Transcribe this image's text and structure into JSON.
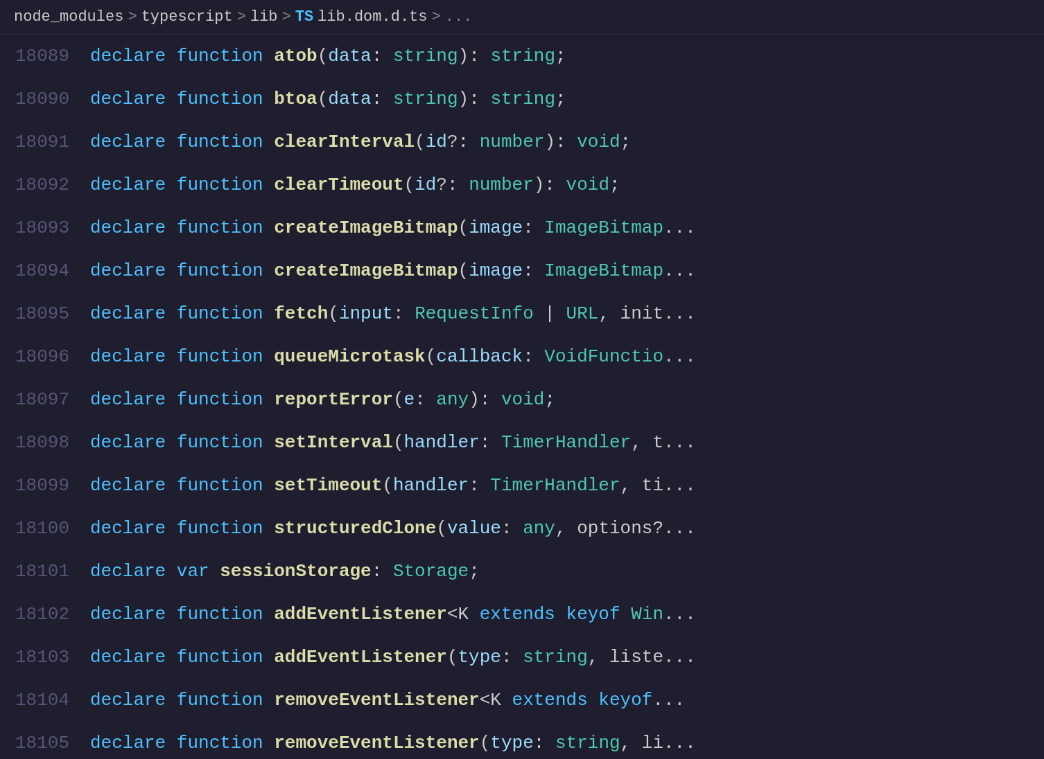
{
  "breadcrumb": {
    "path": [
      "node_modules",
      "typescript",
      "lib"
    ],
    "ts_badge": "TS",
    "filename": "lib.dom.d.ts",
    "ellipsis": "..."
  },
  "lines": [
    {
      "number": "18089",
      "tokens": [
        {
          "t": "declare",
          "c": "kw-declare"
        },
        {
          "t": " "
        },
        {
          "t": "function",
          "c": "kw-function"
        },
        {
          "t": " "
        },
        {
          "t": "atob",
          "c": "fn-name"
        },
        {
          "t": "("
        },
        {
          "t": "data",
          "c": "param-name"
        },
        {
          "t": ": "
        },
        {
          "t": "string",
          "c": "kw-string"
        },
        {
          "t": "): "
        },
        {
          "t": "string",
          "c": "kw-string"
        },
        {
          "t": ";"
        }
      ]
    },
    {
      "number": "18090",
      "tokens": [
        {
          "t": "declare",
          "c": "kw-declare"
        },
        {
          "t": " "
        },
        {
          "t": "function",
          "c": "kw-function"
        },
        {
          "t": " "
        },
        {
          "t": "btoa",
          "c": "fn-name"
        },
        {
          "t": "("
        },
        {
          "t": "data",
          "c": "param-name"
        },
        {
          "t": ": "
        },
        {
          "t": "string",
          "c": "kw-string"
        },
        {
          "t": "): "
        },
        {
          "t": "string",
          "c": "kw-string"
        },
        {
          "t": ";"
        }
      ]
    },
    {
      "number": "18091",
      "tokens": [
        {
          "t": "declare",
          "c": "kw-declare"
        },
        {
          "t": " "
        },
        {
          "t": "function",
          "c": "kw-function"
        },
        {
          "t": " "
        },
        {
          "t": "clearInterval",
          "c": "fn-name"
        },
        {
          "t": "("
        },
        {
          "t": "id",
          "c": "param-name"
        },
        {
          "t": "?: "
        },
        {
          "t": "number",
          "c": "kw-number"
        },
        {
          "t": "): "
        },
        {
          "t": "void",
          "c": "kw-void"
        },
        {
          "t": ";"
        }
      ]
    },
    {
      "number": "18092",
      "tokens": [
        {
          "t": "declare",
          "c": "kw-declare"
        },
        {
          "t": " "
        },
        {
          "t": "function",
          "c": "kw-function"
        },
        {
          "t": " "
        },
        {
          "t": "clearTimeout",
          "c": "fn-name"
        },
        {
          "t": "("
        },
        {
          "t": "id",
          "c": "param-name"
        },
        {
          "t": "?: "
        },
        {
          "t": "number",
          "c": "kw-number"
        },
        {
          "t": "): "
        },
        {
          "t": "void",
          "c": "kw-void"
        },
        {
          "t": ";"
        }
      ]
    },
    {
      "number": "18093",
      "tokens": [
        {
          "t": "declare",
          "c": "kw-declare"
        },
        {
          "t": " "
        },
        {
          "t": "function",
          "c": "kw-function"
        },
        {
          "t": " "
        },
        {
          "t": "createImageBitmap",
          "c": "fn-name"
        },
        {
          "t": "("
        },
        {
          "t": "image",
          "c": "param-name"
        },
        {
          "t": ": "
        },
        {
          "t": "ImageBitmap",
          "c": "type-name"
        },
        {
          "t": "..."
        }
      ]
    },
    {
      "number": "18094",
      "tokens": [
        {
          "t": "declare",
          "c": "kw-declare"
        },
        {
          "t": " "
        },
        {
          "t": "function",
          "c": "kw-function"
        },
        {
          "t": " "
        },
        {
          "t": "createImageBitmap",
          "c": "fn-name"
        },
        {
          "t": "("
        },
        {
          "t": "image",
          "c": "param-name"
        },
        {
          "t": ": "
        },
        {
          "t": "ImageBitmap",
          "c": "type-name"
        },
        {
          "t": "..."
        }
      ]
    },
    {
      "number": "18095",
      "tokens": [
        {
          "t": "declare",
          "c": "kw-declare"
        },
        {
          "t": " "
        },
        {
          "t": "function",
          "c": "kw-function"
        },
        {
          "t": " "
        },
        {
          "t": "fetch",
          "c": "fn-name"
        },
        {
          "t": "("
        },
        {
          "t": "input",
          "c": "param-name"
        },
        {
          "t": ": "
        },
        {
          "t": "RequestInfo",
          "c": "type-name"
        },
        {
          "t": " | "
        },
        {
          "t": "URL",
          "c": "type-name"
        },
        {
          "t": ", init..."
        }
      ]
    },
    {
      "number": "18096",
      "tokens": [
        {
          "t": "declare",
          "c": "kw-declare"
        },
        {
          "t": " "
        },
        {
          "t": "function",
          "c": "kw-function"
        },
        {
          "t": " "
        },
        {
          "t": "queueMicrotask",
          "c": "fn-name"
        },
        {
          "t": "("
        },
        {
          "t": "callback",
          "c": "param-name"
        },
        {
          "t": ": "
        },
        {
          "t": "VoidFunctio",
          "c": "type-name"
        },
        {
          "t": "..."
        }
      ]
    },
    {
      "number": "18097",
      "tokens": [
        {
          "t": "declare",
          "c": "kw-declare"
        },
        {
          "t": " "
        },
        {
          "t": "function",
          "c": "kw-function"
        },
        {
          "t": " "
        },
        {
          "t": "reportError",
          "c": "fn-name"
        },
        {
          "t": "("
        },
        {
          "t": "e",
          "c": "param-name"
        },
        {
          "t": ": "
        },
        {
          "t": "any",
          "c": "keyword-any"
        },
        {
          "t": "): "
        },
        {
          "t": "void",
          "c": "kw-void"
        },
        {
          "t": ";"
        }
      ]
    },
    {
      "number": "18098",
      "tokens": [
        {
          "t": "declare",
          "c": "kw-declare"
        },
        {
          "t": " "
        },
        {
          "t": "function",
          "c": "kw-function"
        },
        {
          "t": " "
        },
        {
          "t": "setInterval",
          "c": "fn-name"
        },
        {
          "t": "("
        },
        {
          "t": "handler",
          "c": "param-name"
        },
        {
          "t": ": "
        },
        {
          "t": "TimerHandler",
          "c": "type-name"
        },
        {
          "t": ", t..."
        }
      ]
    },
    {
      "number": "18099",
      "tokens": [
        {
          "t": "declare",
          "c": "kw-declare"
        },
        {
          "t": " "
        },
        {
          "t": "function",
          "c": "kw-function"
        },
        {
          "t": " "
        },
        {
          "t": "setTimeout",
          "c": "fn-name"
        },
        {
          "t": "("
        },
        {
          "t": "handler",
          "c": "param-name"
        },
        {
          "t": ": "
        },
        {
          "t": "TimerHandler",
          "c": "type-name"
        },
        {
          "t": ", ti..."
        }
      ]
    },
    {
      "number": "18100",
      "tokens": [
        {
          "t": "declare",
          "c": "kw-declare"
        },
        {
          "t": " "
        },
        {
          "t": "function",
          "c": "kw-function"
        },
        {
          "t": " "
        },
        {
          "t": "structuredClone",
          "c": "fn-name"
        },
        {
          "t": "("
        },
        {
          "t": "value",
          "c": "param-name"
        },
        {
          "t": ": "
        },
        {
          "t": "any",
          "c": "keyword-any"
        },
        {
          "t": ", options?..."
        }
      ]
    },
    {
      "number": "18101",
      "tokens": [
        {
          "t": "declare",
          "c": "kw-declare"
        },
        {
          "t": " "
        },
        {
          "t": "var",
          "c": "kw-var"
        },
        {
          "t": " "
        },
        {
          "t": "sessionStorage",
          "c": "fn-name"
        },
        {
          "t": ": "
        },
        {
          "t": "Storage",
          "c": "type-name"
        },
        {
          "t": ";"
        }
      ]
    },
    {
      "number": "18102",
      "tokens": [
        {
          "t": "declare",
          "c": "kw-declare"
        },
        {
          "t": " "
        },
        {
          "t": "function",
          "c": "kw-function"
        },
        {
          "t": " "
        },
        {
          "t": "addEventListener",
          "c": "fn-name"
        },
        {
          "t": "<K "
        },
        {
          "t": "extends",
          "c": "kw-extends"
        },
        {
          "t": " "
        },
        {
          "t": "keyof",
          "c": "kw-keyof"
        },
        {
          "t": " "
        },
        {
          "t": "Win",
          "c": "type-name"
        },
        {
          "t": "..."
        }
      ]
    },
    {
      "number": "18103",
      "tokens": [
        {
          "t": "declare",
          "c": "kw-declare"
        },
        {
          "t": " "
        },
        {
          "t": "function",
          "c": "kw-function"
        },
        {
          "t": " "
        },
        {
          "t": "addEventListener",
          "c": "fn-name"
        },
        {
          "t": "("
        },
        {
          "t": "type",
          "c": "param-name"
        },
        {
          "t": ": "
        },
        {
          "t": "string",
          "c": "kw-string"
        },
        {
          "t": ", liste..."
        }
      ]
    },
    {
      "number": "18104",
      "tokens": [
        {
          "t": "declare",
          "c": "kw-declare"
        },
        {
          "t": " "
        },
        {
          "t": "function",
          "c": "kw-function"
        },
        {
          "t": " "
        },
        {
          "t": "removeEventListener",
          "c": "fn-name"
        },
        {
          "t": "<K "
        },
        {
          "t": "extends",
          "c": "kw-extends"
        },
        {
          "t": " "
        },
        {
          "t": "keyof",
          "c": "kw-keyof"
        },
        {
          "t": "..."
        }
      ]
    },
    {
      "number": "18105",
      "tokens": [
        {
          "t": "declare",
          "c": "kw-declare"
        },
        {
          "t": " "
        },
        {
          "t": "function",
          "c": "kw-function"
        },
        {
          "t": " "
        },
        {
          "t": "removeEventListener",
          "c": "fn-name"
        },
        {
          "t": "("
        },
        {
          "t": "type",
          "c": "param-name"
        },
        {
          "t": ": "
        },
        {
          "t": "string",
          "c": "kw-string"
        },
        {
          "t": ", li..."
        }
      ]
    }
  ]
}
